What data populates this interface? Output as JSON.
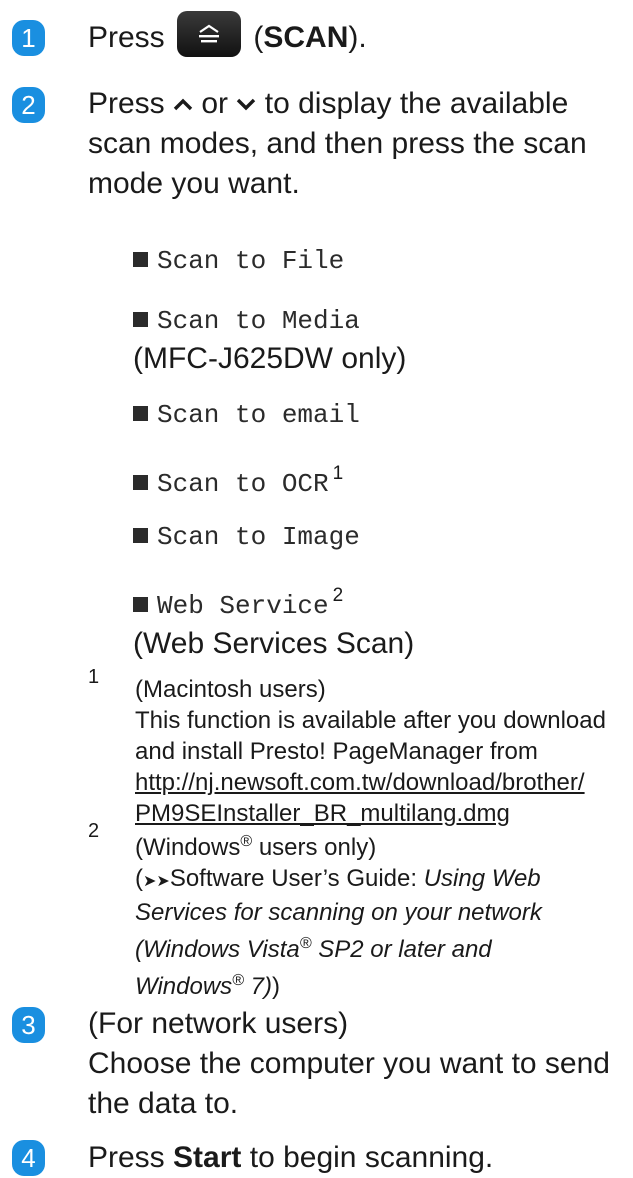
{
  "steps": [
    {
      "num": "1",
      "pre": "Press",
      "paren_open": " (",
      "bold": "SCAN",
      "paren_close": ")."
    },
    {
      "num": "2",
      "text_a": "Press",
      "text_b": "or",
      "text_c": "to display the available",
      "line2": "scan modes, and then press the scan",
      "line3": "mode you want."
    },
    {
      "num": "3",
      "line1": "(For network users)",
      "line2": "Choose the computer you want to send",
      "line3": "the data to."
    },
    {
      "num": "4",
      "pre": "Press",
      "bold": "Start",
      "post": "to begin scanning."
    }
  ],
  "scan_modes": [
    {
      "label": "Scan to File"
    },
    {
      "label": "Scan to Media",
      "sub": "(MFC-J625DW only)"
    },
    {
      "label": "Scan to email"
    },
    {
      "label": "Scan to OCR",
      "sup": "1"
    },
    {
      "label": "Scan to Image"
    },
    {
      "label": "Web Service",
      "sup": "2",
      "sub": "(Web Services Scan)"
    }
  ],
  "footnotes": [
    {
      "num": "1",
      "l1": "(Macintosh users)",
      "l2": "This function is available after you download",
      "l3": "and install Presto! PageManager from",
      "link1": "http://nj.newsoft.com.tw/download/brother/",
      "link2": "PM9SEInstaller_BR_multilang.dmg"
    },
    {
      "num": "2",
      "l1_pre": "(Windows",
      "reg": "®",
      "l1_post": " users only)",
      "l2_pre": "(",
      "arrows": "➤➤",
      "l2_main": "Software User’s Guide: ",
      "l2_italic": "Using Web",
      "l3_italic": "Services for scanning on your network",
      "l4_italic_a": "(Windows Vista",
      "l4_italic_b": " SP2 or later and",
      "l5_italic_a": "Windows",
      "l5_italic_b": " 7)",
      "l5_tail": ")"
    }
  ]
}
